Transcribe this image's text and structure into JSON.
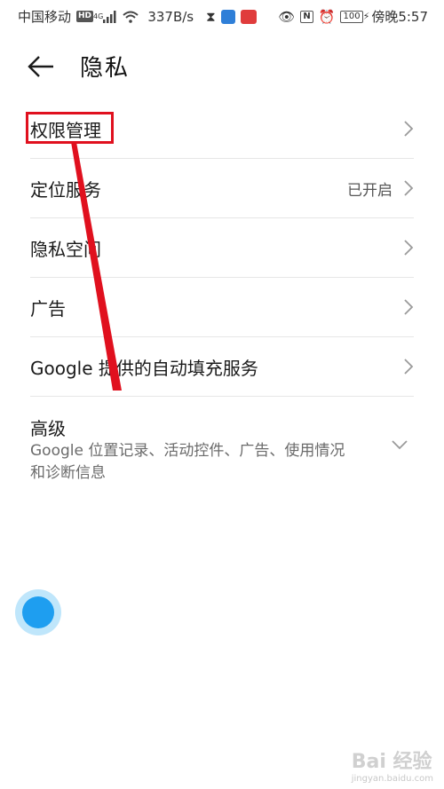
{
  "status_bar": {
    "carrier": "中国移动",
    "hd": "HD",
    "network": "4G",
    "speed": "337B/s",
    "battery": "100",
    "time": "傍晚5:57",
    "nfc": "N"
  },
  "header": {
    "title": "隐私"
  },
  "list": {
    "items": [
      {
        "label": "权限管理",
        "value": ""
      },
      {
        "label": "定位服务",
        "value": "已开启"
      },
      {
        "label": "隐私空间",
        "value": ""
      },
      {
        "label": "广告",
        "value": ""
      },
      {
        "label": "Google 提供的自动填充服务",
        "value": ""
      }
    ],
    "advanced": {
      "label": "高级",
      "desc": "Google 位置记录、活动控件、广告、使用情况和诊断信息"
    }
  },
  "watermark": {
    "text": "Bai 经验",
    "sub": "jingyan.baidu.com"
  },
  "colors": {
    "highlight": "#e0101e",
    "float_ball": "#1e9ef0"
  }
}
